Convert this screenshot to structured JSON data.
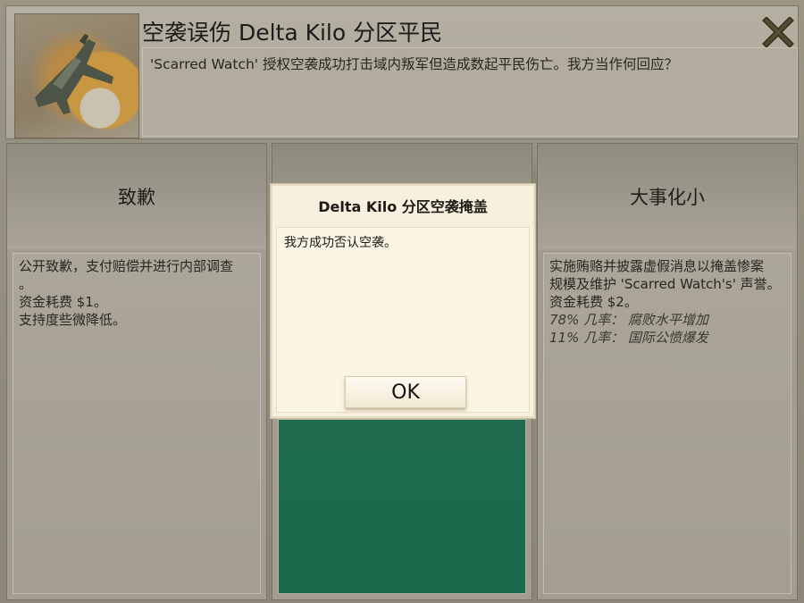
{
  "event": {
    "title": "空袭误伤 Delta Kilo 分区平民",
    "description": "'Scarred Watch' 授权空袭成功打击域内叛军但造成数起平民伤亡。我方当作何回应？",
    "image_icon": "airstrike-jet-explosion-icon",
    "close_icon": "close-x-icon"
  },
  "options": [
    {
      "title": "致歉",
      "lines": [
        "公开致歉，支付赔偿并进行内部调查",
        "。",
        "资金耗费 $1。",
        "支持度些微降低。"
      ]
    },
    {
      "title": "",
      "lines": []
    },
    {
      "title": "大事化小",
      "lines": [
        "实施贿赂并披露虚假消息以掩盖惨案",
        "规模及维护 'Scarred Watch's' 声誉。",
        "资金耗费 $2。"
      ],
      "risks": [
        "78% 几率： 腐败水平增加",
        "11% 几率： 国际公愤爆发"
      ]
    }
  ],
  "dialog": {
    "title": "Delta Kilo 分区空袭掩盖",
    "message": "我方成功否认空袭。",
    "ok_label": "OK"
  },
  "colors": {
    "green_panel": "#1b6a4b",
    "dialog_bg": "#f7f0de",
    "panel_bg": "#a29d90"
  }
}
